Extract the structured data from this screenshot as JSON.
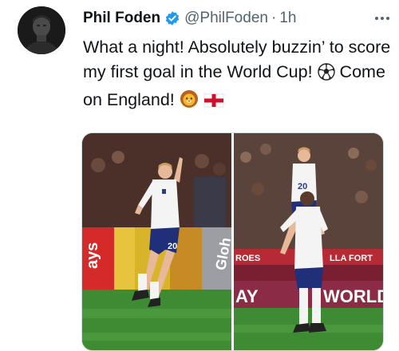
{
  "tweet": {
    "display_name": "Phil Foden",
    "handle": "@PhilFoden",
    "separator": "·",
    "time": "1h",
    "text_part1": "What a night! Absolutely buzzin’ to score my first goal in the World Cup!",
    "text_part2": "Come on England!"
  },
  "media": {
    "photo1": {
      "ad_left": "ays",
      "ad_right": "Gloh",
      "shirt_number": "20"
    },
    "photo2": {
      "banner_left": "AY",
      "banner_right": "WORLD",
      "board_left": "ROES",
      "board_right": "LLA FORT",
      "shirt_number": "20"
    }
  },
  "colors": {
    "verified": "#1d9bf0",
    "muted_text": "#536471",
    "pitch_green": "#3f8b34"
  },
  "icons": [
    "verified-badge-icon",
    "more-options-icon",
    "soccer-ball-icon",
    "lion-face-icon",
    "england-flag-icon"
  ]
}
